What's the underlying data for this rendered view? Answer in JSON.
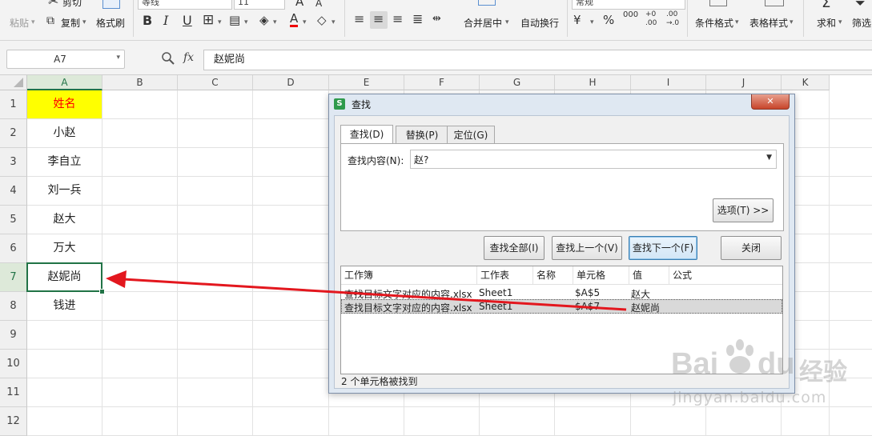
{
  "ribbon": {
    "paste": "粘贴",
    "cut": "剪切",
    "copy": "复制",
    "format_painter": "格式刷",
    "font_name": "等线",
    "font_size": "11",
    "merge_center": "合并居中",
    "wrap_text": "自动换行",
    "number_format": "常规",
    "conditional_format": "条件格式",
    "table_style": "表格样式",
    "sum": "求和",
    "filter": "筛选",
    "bold": "B",
    "italic": "I",
    "underline": "U"
  },
  "formula_bar": {
    "cell_ref": "A7",
    "fx": "fx",
    "content": "赵妮尚"
  },
  "sheet": {
    "columns": [
      "A",
      "B",
      "C",
      "D",
      "E",
      "F",
      "G",
      "H",
      "I",
      "J",
      "K"
    ],
    "rows": [
      "1",
      "2",
      "3",
      "4",
      "5",
      "6",
      "7",
      "8",
      "9",
      "10",
      "11",
      "12"
    ],
    "col_a_values": [
      "姓名",
      "小赵",
      "李自立",
      "刘一兵",
      "赵大",
      "万大",
      "赵妮尚",
      "钱进",
      "",
      "",
      "",
      ""
    ],
    "header_fill": "#ffff00",
    "header_text_color": "#ff0000",
    "active_color": "#217346"
  },
  "dialog": {
    "title": "查找",
    "close": "✕",
    "tabs": [
      "查找(D)",
      "替换(P)",
      "定位(G)"
    ],
    "find_label": "查找内容(N):",
    "find_value": "赵?",
    "options_button": "选项(T) >>",
    "btn_find_all": "查找全部(I)",
    "btn_find_prev": "查找上一个(V)",
    "btn_find_next": "查找下一个(F)",
    "btn_close": "关闭",
    "results_headers": [
      "工作簿",
      "工作表",
      "名称",
      "单元格",
      "值",
      "公式"
    ],
    "results": [
      {
        "book": "查找目标文字对应的内容.xlsx",
        "sheet": "Sheet1",
        "name": "",
        "cell": "$A$5",
        "value": "赵大",
        "formula": ""
      },
      {
        "book": "查找目标文字对应的内容.xlsx",
        "sheet": "Sheet1",
        "name": "",
        "cell": "$A$7",
        "value": "赵妮尚",
        "formula": ""
      }
    ],
    "status": "2 个单元格被找到"
  },
  "annotation": {
    "arrow_color": "#e3171e"
  },
  "watermark": {
    "brand": "Bai",
    "brand2": "du",
    "cn": "经验",
    "url": "jingyan.baidu.com"
  }
}
